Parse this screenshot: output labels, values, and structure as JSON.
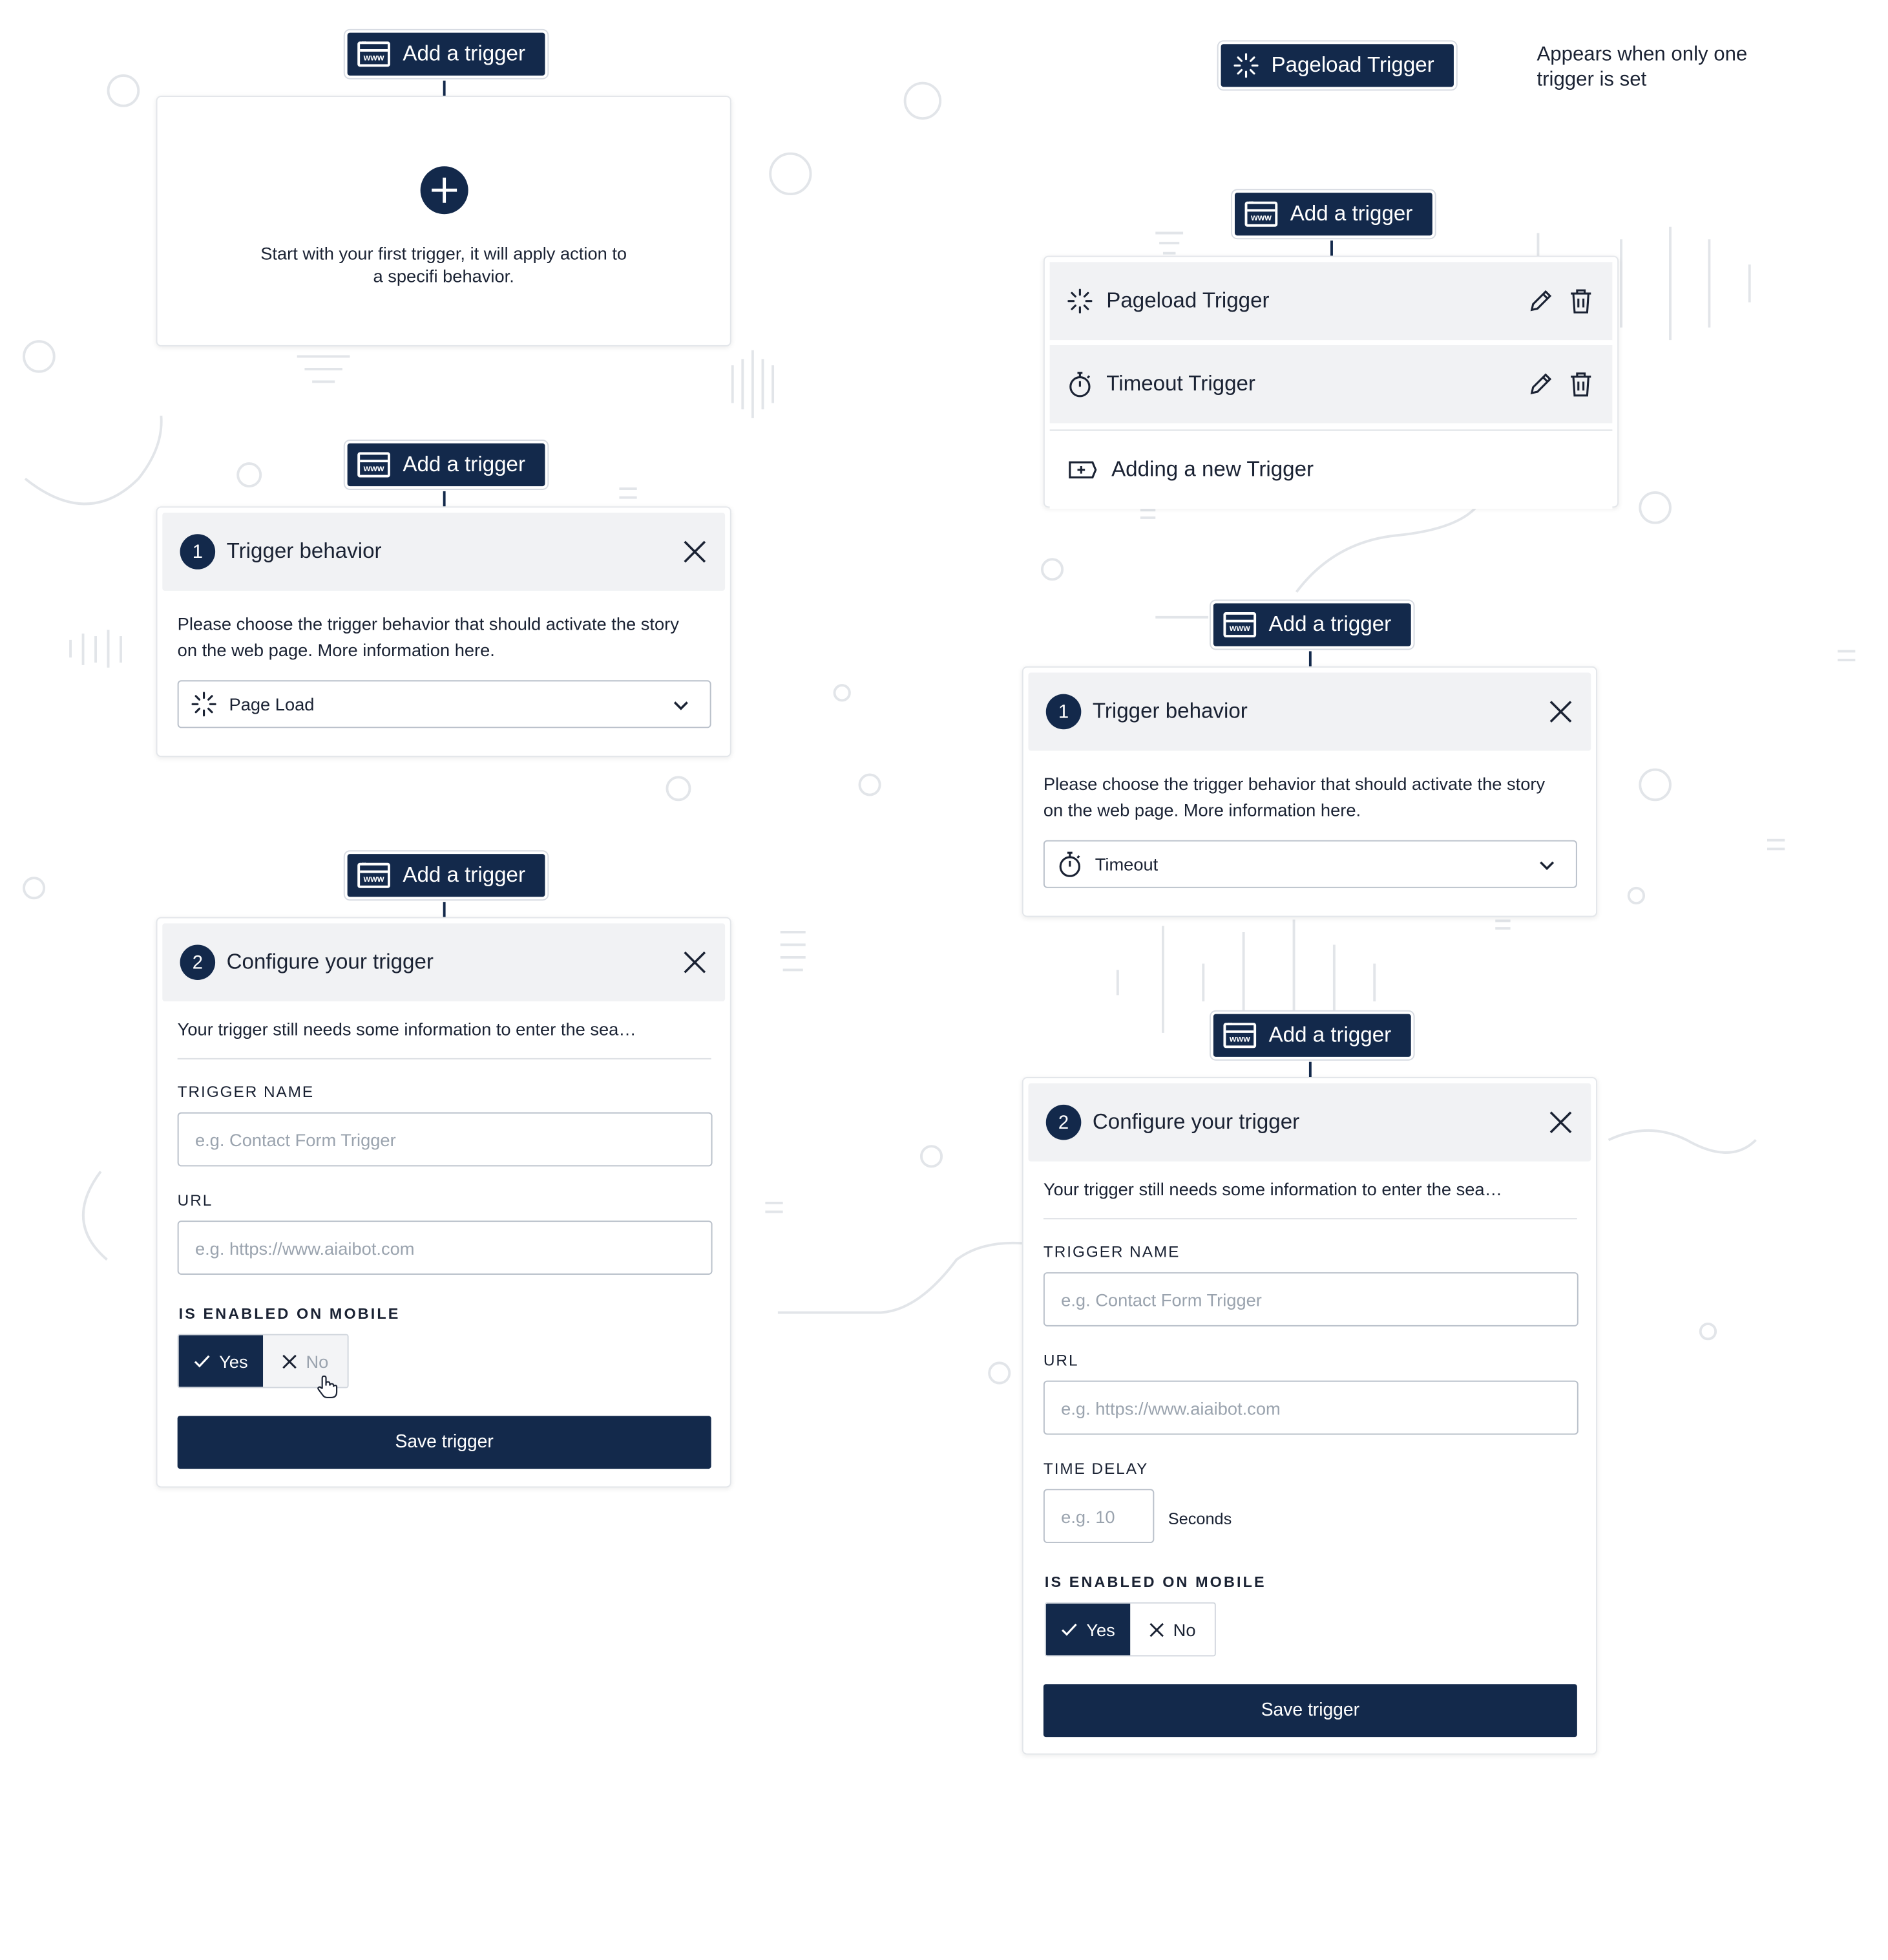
{
  "add_trigger_label": "Add a trigger",
  "www_icon_text": "www",
  "empty_state": {
    "message_line1": "Start with your first trigger, it will apply action to",
    "message_line2": "a specifi behavior."
  },
  "behavior_panel_1": {
    "step": "1",
    "title": "Trigger behavior",
    "desc_line1": "Please choose the trigger behavior that should activate the story",
    "desc_line2": "on the web page. More information here.",
    "selected": "Page Load"
  },
  "configure_panel_1": {
    "step": "2",
    "title": "Configure your trigger",
    "desc": "Your trigger still needs some information to enter the sea…",
    "name_label": "TRIGGER NAME",
    "name_placeholder": "e.g. Contact Form Trigger",
    "url_label": "URL",
    "url_placeholder": "e.g. https://www.aiaibot.com",
    "mobile_label": "IS ENABLED ON MOBILE",
    "yes_label": "Yes",
    "no_label": "No",
    "save_label": "Save trigger"
  },
  "single_trigger": {
    "label": "Pageload Trigger",
    "note_line1": "Appears when only one",
    "note_line2": "trigger is set"
  },
  "trigger_list": {
    "items": [
      {
        "label": "Pageload Trigger",
        "icon": "loading-icon"
      },
      {
        "label": "Timeout Trigger",
        "icon": "stopwatch-icon"
      }
    ],
    "add_new_label": "Adding a new Trigger"
  },
  "behavior_panel_2": {
    "step": "1",
    "title": "Trigger behavior",
    "desc_line1": "Please choose the trigger behavior that should activate the story",
    "desc_line2": "on the web page. More information here.",
    "selected": "Timeout"
  },
  "configure_panel_2": {
    "step": "2",
    "title": "Configure your trigger",
    "desc": "Your trigger still needs some information to enter the sea…",
    "name_label": "TRIGGER NAME",
    "name_placeholder": "e.g. Contact Form Trigger",
    "url_label": "URL",
    "url_placeholder": "e.g. https://www.aiaibot.com",
    "delay_label": "TIME DELAY",
    "delay_placeholder": "e.g. 10",
    "delay_unit": "Seconds",
    "mobile_label": "IS ENABLED ON MOBILE",
    "yes_label": "Yes",
    "no_label": "No",
    "save_label": "Save trigger"
  },
  "colors": {
    "primary": "#13294b",
    "panel_header": "#f1f2f4",
    "decor": "#e2e5e9"
  }
}
